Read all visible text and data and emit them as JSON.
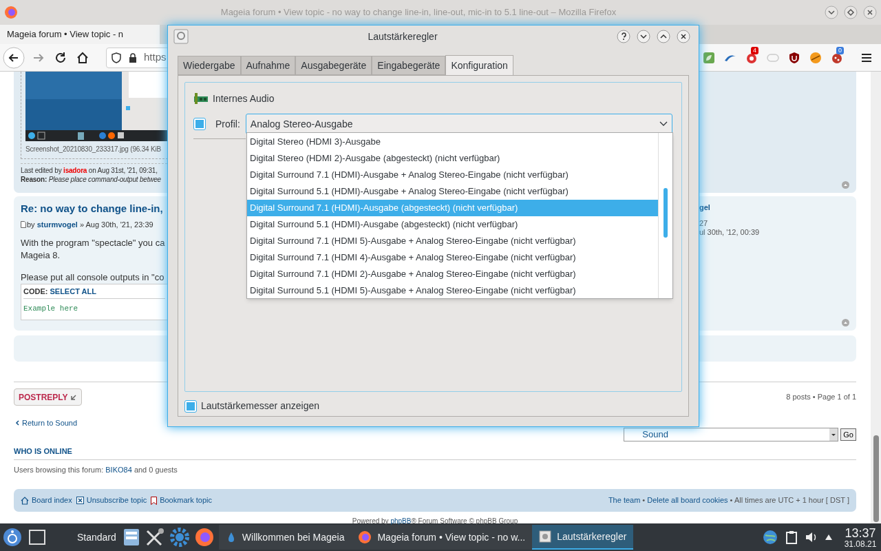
{
  "browser": {
    "title": "Mageia forum • View topic - no way to change line-in, line-out, mic-in to 5.1 line-out – Mozilla Firefox",
    "tab": "Mageia forum • View topic - n",
    "url": "https",
    "badges": [
      "4",
      "0"
    ]
  },
  "attachment": {
    "caption": "Screenshot_20210830_233317.jpg (96.34 KiB"
  },
  "edit_note": {
    "prefix": "Last edited by",
    "user": "isadora",
    "suffix": "on Aug 31st, '21, 09:31,",
    "reason": "**Reason:** *Please place command-output betwee*"
  },
  "post": {
    "title": "Re: no way to change line-in,",
    "by": "by",
    "author": "sturmvogel",
    "date": "» Aug 30th, '21, 23:39",
    "body": [
      "With the program \"spectacle\" you ca",
      "Mageia 8."
    ],
    "note": "Please put all console outputs in \"co",
    "code_label": "CODE:",
    "select_all": "SELECT ALL",
    "code": "Example here",
    "profile": [
      "gel",
      "27",
      "ul 30th, '12, 00:39"
    ]
  },
  "actions": {
    "reply": [
      "POST",
      "REPLY"
    ],
    "pagination": "8 posts • Page 1 of 1",
    "return": "Return to Sound",
    "jump_value": "Sound",
    "go": "Go"
  },
  "online": {
    "heading": "WHO IS ONLINE",
    "prefix": "Users browsing this forum:",
    "user": "BIKO84",
    "suffix": "and 0 guests"
  },
  "footer": {
    "links": [
      "Board index",
      "Unsubscribe topic",
      "Bookmark topic"
    ],
    "team": "The team",
    "sep1": "•",
    "cookies": "Delete all board cookies",
    "times": "• All times are UTC + 1 hour [",
    "dst": "DST",
    "close": "]",
    "powered": [
      "Powered by",
      "phpBB",
      "® Forum Software © phpBB Group"
    ]
  },
  "dialog": {
    "title": "Lautstärkeregler",
    "tabs": [
      {
        "label": "Wiedergabe",
        "selected": false
      },
      {
        "label": "Aufnahme",
        "selected": false
      },
      {
        "label": "Ausgabegeräte",
        "selected": false
      },
      {
        "label": "Eingabegeräte",
        "selected": false
      },
      {
        "label": "Konfiguration",
        "selected": true
      }
    ],
    "device": "Internes Audio",
    "profile": {
      "checked": true,
      "label": "Profil:",
      "value": "Analog Stereo-Ausgabe"
    },
    "options": [
      {
        "label": "Digital Stereo (HDMI 3)-Ausgabe",
        "selected": false
      },
      {
        "label": "Digital Stereo (HDMI 2)-Ausgabe (abgesteckt) (nicht verfügbar)",
        "selected": false
      },
      {
        "label": "Digital Surround 7.1 (HDMI)-Ausgabe + Analog Stereo-Eingabe (nicht verfügbar)",
        "selected": false
      },
      {
        "label": "Digital Surround 5.1 (HDMI)-Ausgabe + Analog Stereo-Eingabe (nicht verfügbar)",
        "selected": false
      },
      {
        "label": "Digital Surround 7.1 (HDMI)-Ausgabe (abgesteckt) (nicht verfügbar)",
        "selected": true
      },
      {
        "label": "Digital Surround 5.1 (HDMI)-Ausgabe (abgesteckt) (nicht verfügbar)",
        "selected": false
      },
      {
        "label": "Digital Surround 7.1 (HDMI 5)-Ausgabe + Analog Stereo-Eingabe (nicht verfügbar)",
        "selected": false
      },
      {
        "label": "Digital Surround 7.1 (HDMI 4)-Ausgabe + Analog Stereo-Eingabe (nicht verfügbar)",
        "selected": false
      },
      {
        "label": "Digital Surround 7.1 (HDMI 2)-Ausgabe + Analog Stereo-Eingabe (nicht verfügbar)",
        "selected": false
      },
      {
        "label": "Digital Surround 5.1 (HDMI 5)-Ausgabe + Analog Stereo-Eingabe (nicht verfügbar)",
        "selected": false
      }
    ],
    "meter": {
      "checked": true,
      "label": "Lautstärkemesser anzeigen"
    }
  },
  "taskbar": {
    "desktop": "Standard",
    "tasks": [
      {
        "label": "Willkommen bei Mageia",
        "selected": false
      },
      {
        "label": "Mageia forum • View topic - no w...",
        "selected": false
      },
      {
        "label": "Lautstärkeregler",
        "selected": true
      }
    ],
    "time": "13:37",
    "date": "31.08.21"
  }
}
